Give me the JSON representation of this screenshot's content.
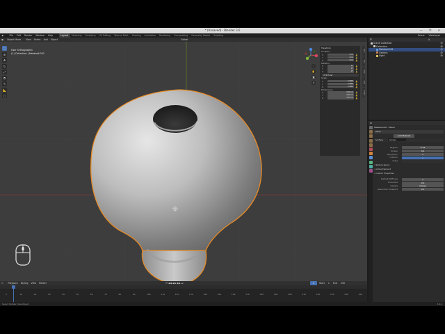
{
  "window": {
    "title": "* (Unsaved) - Blender 3.6",
    "controls": "— ❐ ✕"
  },
  "menubar": {
    "items": [
      "File",
      "Edit",
      "Render",
      "Window",
      "Help"
    ],
    "workspaces": [
      "Layout",
      "Modeling",
      "Sculpting",
      "UV Editing",
      "Texture Paint",
      "Shading",
      "Animation",
      "Rendering",
      "Compositing",
      "Geometry Nodes",
      "Scripting"
    ],
    "scene": "Scene",
    "view_layer": "ViewLayer"
  },
  "viewport": {
    "mode": "Object Mode",
    "menus": [
      "View",
      "Select",
      "Add",
      "Object"
    ],
    "transform": "Global",
    "info_line1": "User Orthographic",
    "info_line2": "(1) Collection | Metaball.001",
    "npanel": {
      "header": "Transform",
      "location_label": "Location:",
      "rotation_label": "Rotation:",
      "scale_label": "Scale:",
      "dimensions_label": "Dimensions:",
      "mode": "XYZ Euler",
      "location": [
        {
          "axis": "X",
          "value": "0 m"
        },
        {
          "axis": "Y",
          "value": "0 m"
        },
        {
          "axis": "Z",
          "value": "0 m"
        }
      ],
      "rotation": [
        {
          "axis": "X",
          "value": "0°"
        },
        {
          "axis": "Y",
          "value": "0°"
        },
        {
          "axis": "Z",
          "value": "0°"
        }
      ],
      "scale": [
        {
          "axis": "X",
          "value": "1.000"
        },
        {
          "axis": "Y",
          "value": "1.000"
        },
        {
          "axis": "Z",
          "value": "1.000"
        }
      ],
      "dimensions": [
        {
          "axis": "X",
          "value": "3.05 m"
        },
        {
          "axis": "Y",
          "value": "2.97 m"
        },
        {
          "axis": "Z",
          "value": "3.47 m"
        }
      ],
      "tabs": [
        "Item",
        "Tool",
        "View",
        "Edit",
        "Create"
      ]
    }
  },
  "timeline": {
    "menus": [
      "Playback",
      "Keying",
      "View",
      "Marker"
    ],
    "current_frame": "1",
    "start_label": "Start",
    "start": "1",
    "end_label": "End",
    "end": "250",
    "ticks": [
      "0",
      "10",
      "20",
      "30",
      "40",
      "50",
      "60",
      "70",
      "80",
      "90",
      "100",
      "110",
      "120",
      "130",
      "140",
      "150",
      "160",
      "170",
      "180",
      "190",
      "200",
      "210",
      "220",
      "230",
      "240",
      "250"
    ]
  },
  "statusbar": {
    "left": "Select   Rotate View   Object",
    "version": "3.6.0"
  },
  "outliner": {
    "title": "Scene Collection",
    "rows": [
      {
        "label": "Scene Collection",
        "indent": 0,
        "color": "#cfcfcf",
        "selected": false
      },
      {
        "label": "Collection",
        "indent": 1,
        "color": "#cfcfcf",
        "selected": false
      },
      {
        "label": "Metaball.001",
        "indent": 2,
        "color": "#5aa0d8",
        "selected": true
      },
      {
        "label": "Camera",
        "indent": 2,
        "color": "#cf7f4e",
        "selected": false
      },
      {
        "label": "Light",
        "indent": 2,
        "color": "#d9c25b",
        "selected": false
      }
    ]
  },
  "properties": {
    "breadcrumb": "Metaball.001  ›  Mball",
    "datablock": "Mball",
    "add_button": "Add Material",
    "surface_label": "Surface",
    "mode": "Screen",
    "fields": [
      {
        "label": "Regular",
        "value": "0.19"
      },
      {
        "label": "Screen",
        "value": "0.4"
      },
      {
        "label": "Resolution",
        "value": "2"
      },
      {
        "label": "Uniform",
        "value": "Checked"
      },
      {
        "label": "Cube",
        "value": ""
      }
    ],
    "sections": [
      "Texture Space",
      "Active Element",
      "Custom Properties"
    ],
    "bottom_fields": [
      {
        "label": "Default Stiffness",
        "value": "2"
      },
      {
        "label": "Threshold",
        "value": "0.6"
      },
      {
        "label": "Update",
        "value": "Always"
      },
      {
        "label": "Resolution Viewport",
        "value": "0.2"
      }
    ]
  },
  "colors": {
    "selection_outline": "#e88a25",
    "active_blue": "#4772b3"
  }
}
